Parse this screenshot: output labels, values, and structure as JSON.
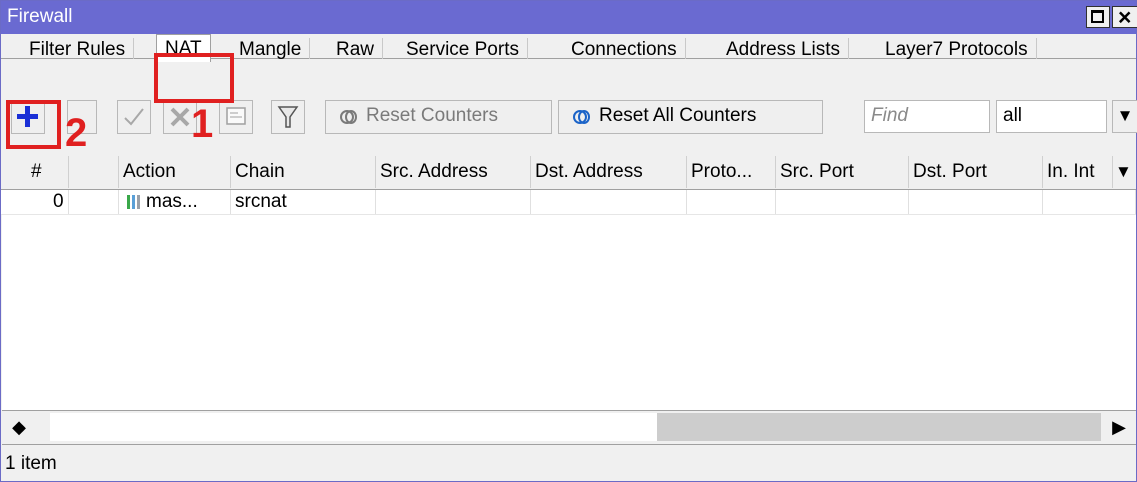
{
  "window": {
    "title": "Firewall"
  },
  "tabs": [
    {
      "label": "Filter Rules"
    },
    {
      "label": "NAT"
    },
    {
      "label": "Mangle"
    },
    {
      "label": "Raw"
    },
    {
      "label": "Service Ports"
    },
    {
      "label": "Connections"
    },
    {
      "label": "Address Lists"
    },
    {
      "label": "Layer7 Protocols"
    }
  ],
  "toolbar": {
    "reset_counters": "Reset Counters",
    "reset_all_counters": "Reset All Counters",
    "find_placeholder": "Find",
    "filter_value": "all"
  },
  "table": {
    "columns": [
      "#",
      "",
      "Action",
      "Chain",
      "Src. Address",
      "Dst. Address",
      "Proto...",
      "Src. Port",
      "Dst. Port",
      "In. Int"
    ],
    "rows": [
      {
        "num": "0",
        "flag": "",
        "action": "mas...",
        "chain": "srcnat",
        "src_address": "",
        "dst_address": "",
        "proto": "",
        "src_port": "",
        "dst_port": "",
        "in_int": ""
      }
    ]
  },
  "status": {
    "count": "1 item"
  },
  "annotations": {
    "one": "1",
    "two": "2"
  },
  "colors": {
    "titlebar": "#6a6ad1",
    "highlight": "#e02020",
    "add_icon": "#1a2fd6"
  }
}
